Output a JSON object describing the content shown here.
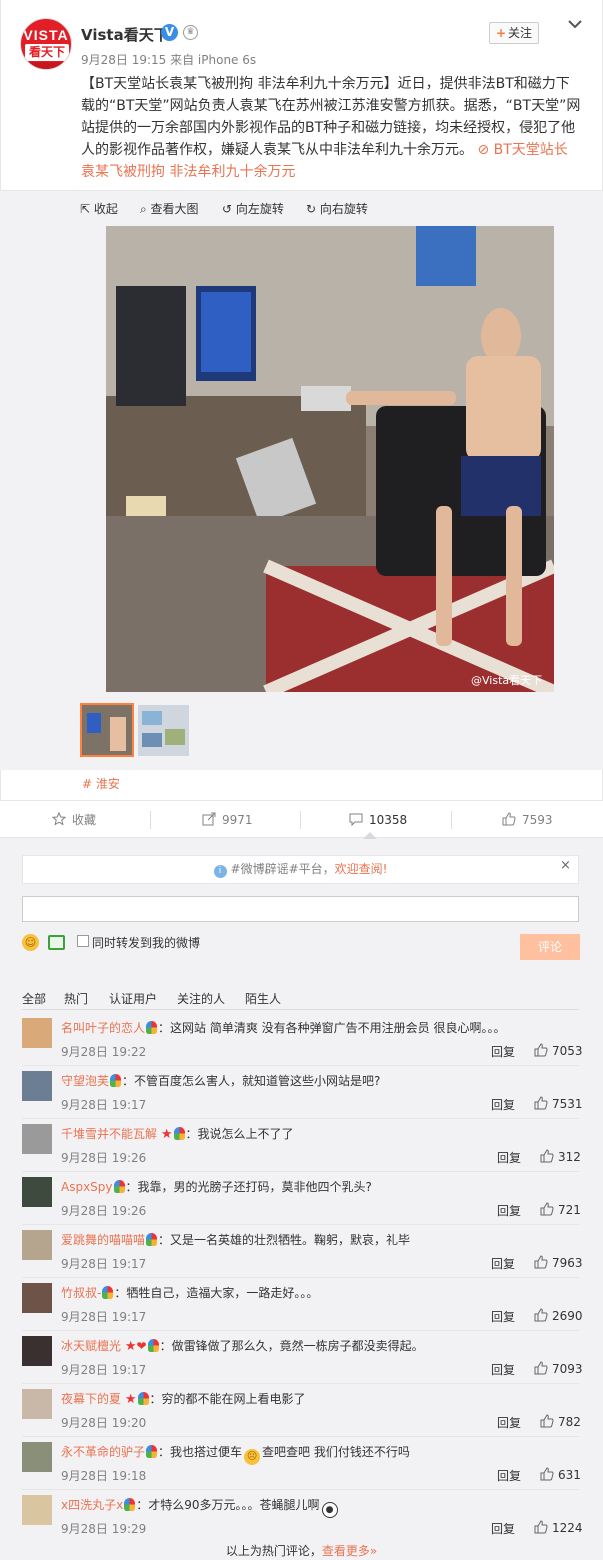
{
  "account": {
    "avatar_top": "VISTA",
    "avatar_mid": "看天下",
    "name": "Vista看天下",
    "verified": "V",
    "meta": "9月28日 19:15 来自 iPhone 6s",
    "follow_plus": "+",
    "follow_label": "关注"
  },
  "post": {
    "hashtag": "【BT天堂站长袁某飞被刑拘 非法牟利九十余万元】",
    "body": "近日，提供非法BT和磁力下载的“BT天堂”网站负责人袁某飞在苏州被江苏淮安警方抓获。据悉，“BT天堂”网站提供的一万余部国内外影视作品的BT种子和磁力链接，均未经授权，侵犯了他人的影视作品著作权，嫌疑人袁某飞从中非法牟利九十余万元。",
    "link_text": "BT天堂站长袁某飞被刑拘 非法牟利九十余万元"
  },
  "media": {
    "tools": [
      "收起",
      "查看大图",
      "向左旋转",
      "向右旋转"
    ],
    "watermark": "@Vista看天下",
    "location": "淮安"
  },
  "actions": {
    "favorite": "收藏",
    "forward": "9971",
    "comment": "10358",
    "like": "7593"
  },
  "comment_box": {
    "notice_prefix": "#微博辟谣#平台，",
    "notice_link": "欢迎查阅!",
    "notice_close": "×",
    "repost_label": "同时转发到我的微博",
    "submit": "评论"
  },
  "tabs": [
    "全部",
    "热门",
    "认证用户",
    "关注的人",
    "陌生人"
  ],
  "comments": [
    {
      "name": "名叫叶子的恋人",
      "text": "：这网站 简单清爽 没有各种弹窗广告不用注册会员 很良心啊。。。",
      "time": "9月28日 19:22",
      "reply": "回复",
      "likes": "7053"
    },
    {
      "name": "守望泡芙",
      "text": "：不管百度怎么害人，就知道管这些小网站是吧?",
      "time": "9月28日 19:17",
      "reply": "回复",
      "likes": "7531"
    },
    {
      "name": "千堆雪并不能瓦解",
      "text": "：我说怎么上不了了",
      "time": "9月28日 19:26",
      "reply": "回复",
      "likes": "312"
    },
    {
      "name": "AspxSpy",
      "text": "：我靠，男的光膀子还打码，莫非他四个乳头?",
      "time": "9月28日 19:26",
      "reply": "回复",
      "likes": "721"
    },
    {
      "name": "爱跳舞的喵喵喵",
      "text": "：又是一名英雄的壮烈牺牲。鞠躬，默哀，礼毕",
      "time": "9月28日 19:17",
      "reply": "回复",
      "likes": "7963"
    },
    {
      "name": "竹叔叔-",
      "text": "：牺牲自己，造福大家，一路走好。。。",
      "time": "9月28日 19:17",
      "reply": "回复",
      "likes": "2690"
    },
    {
      "name": "冰天赋檀光",
      "text": "：做雷锋做了那么久，竟然一栋房子都没卖得起。",
      "time": "9月28日 19:17",
      "reply": "回复",
      "likes": "7093"
    },
    {
      "name": "夜幕下的夏",
      "text": "：穷的都不能在网上看电影了",
      "time": "9月28日 19:20",
      "reply": "回复",
      "likes": "782"
    },
    {
      "name": "永不革命的驴子",
      "text": "：我也搭过便车",
      "text2": "查吧查吧 我们付钱还不行吗",
      "time": "9月28日 19:18",
      "reply": "回复",
      "likes": "631"
    },
    {
      "name": "x四洗丸子x",
      "text": "：才特么90多万元。。。苍蝇腿儿啊",
      "time": "9月28日 19:29",
      "reply": "回复",
      "likes": "1224"
    }
  ],
  "footer": {
    "prefix": "以上为热门评论，",
    "link": "查看更多»"
  },
  "colors": {
    "accent": "#eb7350",
    "brand_red": "#e21e26",
    "submit_disabled": "#ffc09f",
    "verified_blue": "#3a8ee6"
  }
}
